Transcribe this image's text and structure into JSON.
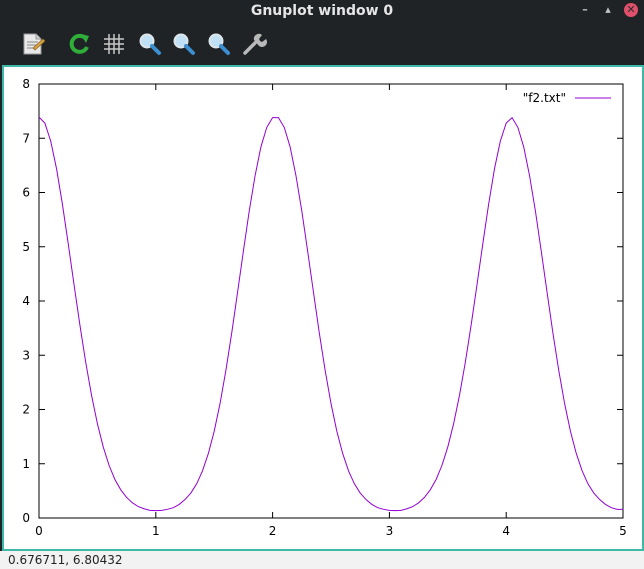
{
  "window": {
    "title": "Gnuplot window 0",
    "controls": {
      "minimize_glyph": "–",
      "maximize_glyph": "▴",
      "close_glyph": "✕"
    }
  },
  "toolbar": {
    "items": [
      {
        "icon": "copy-clipboard-icon",
        "tooltip": ""
      },
      {
        "icon": "replot-icon",
        "tooltip": ""
      },
      {
        "icon": "grid-icon",
        "tooltip": ""
      },
      {
        "icon": "zoom-previous-icon",
        "tooltip": ""
      },
      {
        "icon": "zoom-next-icon",
        "tooltip": ""
      },
      {
        "icon": "autoscale-icon",
        "tooltip": ""
      },
      {
        "icon": "settings-wrench-icon",
        "tooltip": ""
      }
    ]
  },
  "statusbar": {
    "coordinates": "0.676711,  6.80432"
  },
  "colors": {
    "series": "#9400d3",
    "frame_border": "#3fb8a8"
  },
  "chart_data": {
    "type": "line",
    "title": "",
    "xlabel": "",
    "ylabel": "",
    "xlim": [
      0,
      5
    ],
    "ylim": [
      0,
      8
    ],
    "xticks": [
      0,
      1,
      2,
      3,
      4,
      5
    ],
    "yticks": [
      0,
      1,
      2,
      3,
      4,
      5,
      6,
      7,
      8
    ],
    "grid": false,
    "legend_position": "top-right",
    "series": [
      {
        "name": "\"f2.txt\"",
        "color": "#9400d3",
        "x": [
          0.0,
          0.05,
          0.1,
          0.15,
          0.2,
          0.25,
          0.3,
          0.35,
          0.4,
          0.45,
          0.5,
          0.55,
          0.6,
          0.65,
          0.7,
          0.75,
          0.8,
          0.85,
          0.9,
          0.95,
          1.0,
          1.05,
          1.1,
          1.15,
          1.2,
          1.25,
          1.3,
          1.35,
          1.4,
          1.45,
          1.5,
          1.55,
          1.6,
          1.65,
          1.7,
          1.75,
          1.8,
          1.85,
          1.9,
          1.95,
          2.0,
          2.05,
          2.1,
          2.15,
          2.2,
          2.25,
          2.3,
          2.35,
          2.4,
          2.45,
          2.5,
          2.55,
          2.6,
          2.65,
          2.7,
          2.75,
          2.8,
          2.85,
          2.9,
          2.95,
          3.0,
          3.05,
          3.1,
          3.15,
          3.2,
          3.25,
          3.3,
          3.35,
          3.4,
          3.45,
          3.5,
          3.55,
          3.6,
          3.65,
          3.7,
          3.75,
          3.8,
          3.85,
          3.9,
          3.95,
          4.0,
          4.05,
          4.1,
          4.15,
          4.2,
          4.25,
          4.3,
          4.35,
          4.4,
          4.45,
          4.5,
          4.55,
          4.6,
          4.65,
          4.7,
          4.75,
          4.8,
          4.85,
          4.9,
          4.95,
          5.0
        ],
        "y": [
          7.39,
          7.28,
          6.95,
          6.44,
          5.79,
          5.06,
          4.3,
          3.56,
          2.87,
          2.26,
          1.74,
          1.31,
          0.97,
          0.71,
          0.52,
          0.38,
          0.28,
          0.21,
          0.17,
          0.14,
          0.135,
          0.14,
          0.16,
          0.19,
          0.25,
          0.34,
          0.46,
          0.63,
          0.87,
          1.19,
          1.6,
          2.11,
          2.72,
          3.41,
          4.16,
          4.92,
          5.66,
          6.31,
          6.84,
          7.2,
          7.38,
          7.38,
          7.2,
          6.84,
          6.31,
          5.66,
          4.92,
          4.16,
          3.41,
          2.72,
          2.11,
          1.6,
          1.19,
          0.87,
          0.63,
          0.46,
          0.34,
          0.25,
          0.19,
          0.16,
          0.14,
          0.135,
          0.14,
          0.17,
          0.21,
          0.28,
          0.38,
          0.52,
          0.71,
          0.97,
          1.31,
          1.74,
          2.26,
          2.87,
          3.56,
          4.3,
          5.06,
          5.79,
          6.44,
          6.95,
          7.28,
          7.38,
          7.2,
          6.84,
          6.31,
          5.66,
          4.92,
          4.16,
          3.41,
          2.72,
          2.11,
          1.6,
          1.19,
          0.87,
          0.63,
          0.46,
          0.34,
          0.25,
          0.19,
          0.16,
          0.16
        ]
      }
    ]
  }
}
